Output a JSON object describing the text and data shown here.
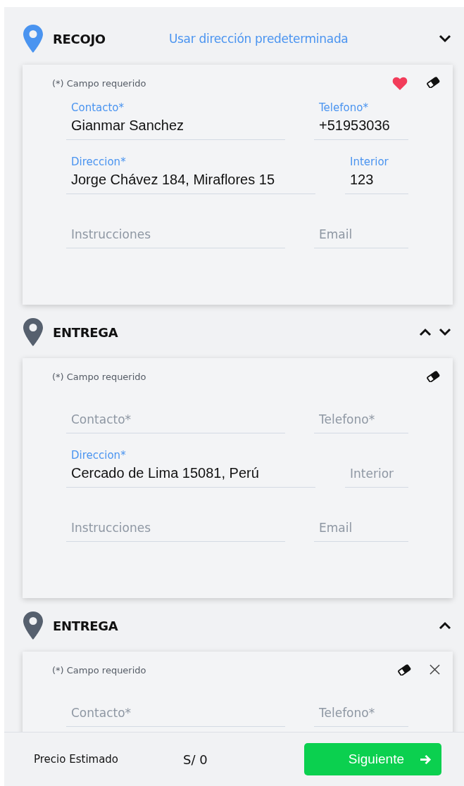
{
  "sections": [
    {
      "kind": "pickup",
      "title": "RECOJO",
      "link": "Usar dirección predeterminada",
      "up_arrow": false,
      "down_arrow": true,
      "card": {
        "note": "(*) Campo requerido",
        "favorite": true,
        "clear": true,
        "removable": false,
        "rows": [
          {
            "kind": "pair",
            "fields": [
              {
                "label": "Contacto*",
                "value": "Gianmar Sanchez"
              },
              {
                "label": "Telefono*",
                "value": "+51953036"
              }
            ]
          },
          {
            "kind": "address",
            "fields": [
              {
                "label": "Direccion*",
                "value": "Jorge Chávez 184, Miraflores 15"
              },
              {
                "label": "Interior",
                "value": "123"
              }
            ]
          },
          {
            "kind": "pair",
            "fields": [
              {
                "placeholder": "Instrucciones"
              },
              {
                "placeholder": "Email"
              }
            ]
          }
        ]
      }
    },
    {
      "kind": "delivery",
      "title": "ENTREGA",
      "up_arrow": true,
      "down_arrow": true,
      "card": {
        "note": "(*) Campo requerido",
        "favorite": false,
        "clear": true,
        "removable": false,
        "rows": [
          {
            "kind": "pair",
            "fields": [
              {
                "placeholder": "Contacto*"
              },
              {
                "placeholder": "Telefono*"
              }
            ]
          },
          {
            "kind": "address",
            "fields": [
              {
                "label": "Direccion*",
                "value": "Cercado de Lima 15081, Perú"
              },
              {
                "placeholder": "Interior"
              }
            ]
          },
          {
            "kind": "pair",
            "fields": [
              {
                "placeholder": "Instrucciones"
              },
              {
                "placeholder": "Email"
              }
            ]
          }
        ]
      }
    },
    {
      "kind": "delivery",
      "title": "ENTREGA",
      "up_arrow": true,
      "down_arrow": false,
      "card": {
        "note": "(*) Campo requerido",
        "favorite": false,
        "clear": true,
        "removable": true,
        "rows": [
          {
            "kind": "pair",
            "fields": [
              {
                "placeholder": "Contacto*"
              },
              {
                "placeholder": "Telefono*"
              }
            ]
          }
        ]
      }
    }
  ],
  "footer": {
    "price_label": "Precio Estimado",
    "price": "S/ 0",
    "button": "Siguiente"
  }
}
